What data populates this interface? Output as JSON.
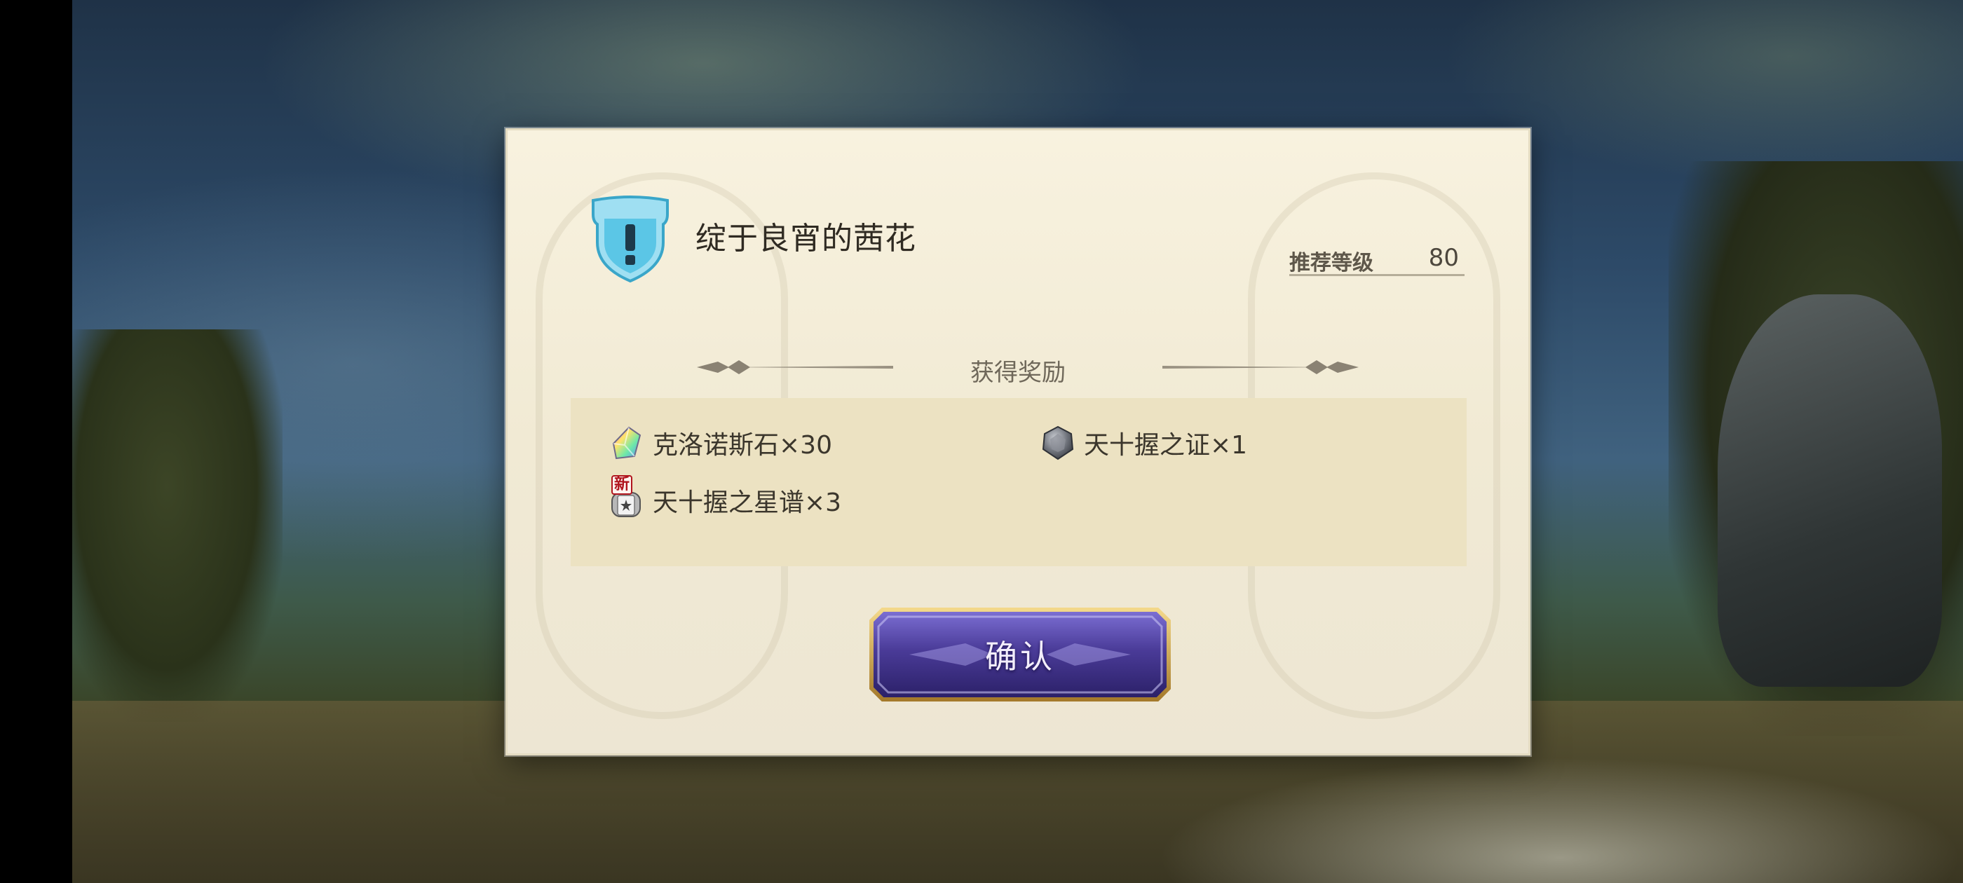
{
  "dialog": {
    "quest_title": "绽于良宵的茜花",
    "level_label": "推荐等级",
    "level_value": "80",
    "reward_header": "获得奖励",
    "rewards": [
      {
        "name": "克洛诺斯石×30",
        "icon": "chronos-stone-icon"
      },
      {
        "name": "天十握之证×1",
        "icon": "proof-medal-icon"
      },
      {
        "name": "天十握之星谱×3",
        "icon": "star-score-icon",
        "badge": "新"
      }
    ],
    "confirm_label": "确认"
  },
  "colors": {
    "dialog_bg": "#f4eedb",
    "reward_box_bg": "#ece2c2",
    "button_purple": "#4a3b98",
    "button_gold": "#c9a04a",
    "shield_blue": "#5bc6e6"
  }
}
